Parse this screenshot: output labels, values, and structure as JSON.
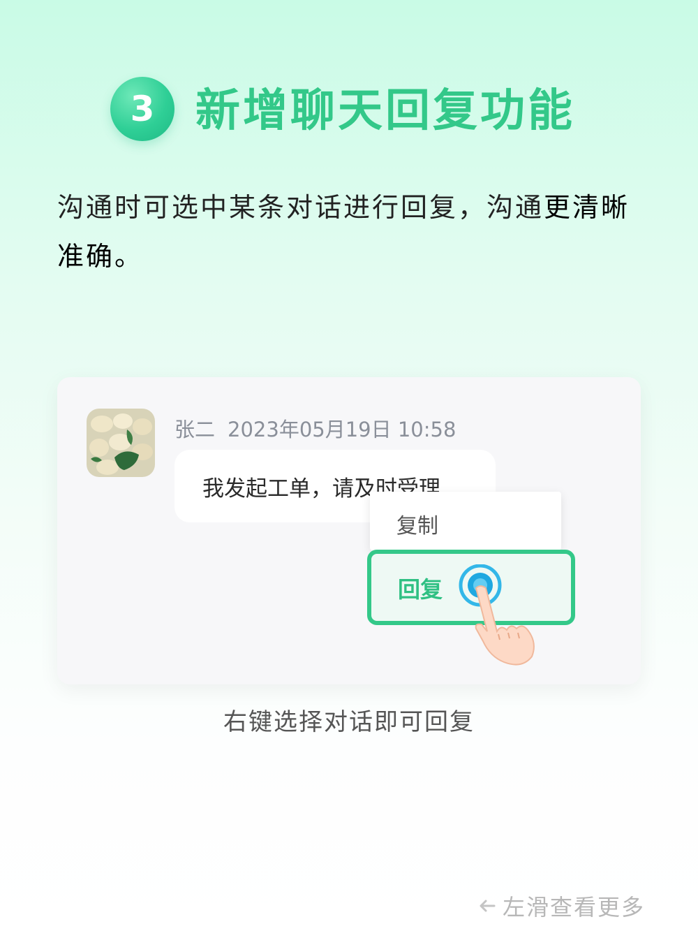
{
  "heading": {
    "step": "3",
    "title": "新增聊天回复功能"
  },
  "description": {
    "part1": "沟通时可选中某条对话进行回复，沟通",
    "part2": "更清晰准确。"
  },
  "chat": {
    "avatar_icon": "food-photo-avatar",
    "sender": "张二",
    "timestamp": "2023年05月19日 10:58",
    "message": "我发起工单，请及时受理"
  },
  "context_menu": {
    "items": [
      {
        "label": "复制"
      },
      {
        "label": "回复"
      }
    ],
    "selected": "回复"
  },
  "caption": "右键选择对话即可回复",
  "swipe_hint": {
    "icon": "arrow-left-icon",
    "label": "左滑查看更多"
  },
  "colors": {
    "accent": "#34c889",
    "title": "#33c889",
    "text": "#222222"
  }
}
